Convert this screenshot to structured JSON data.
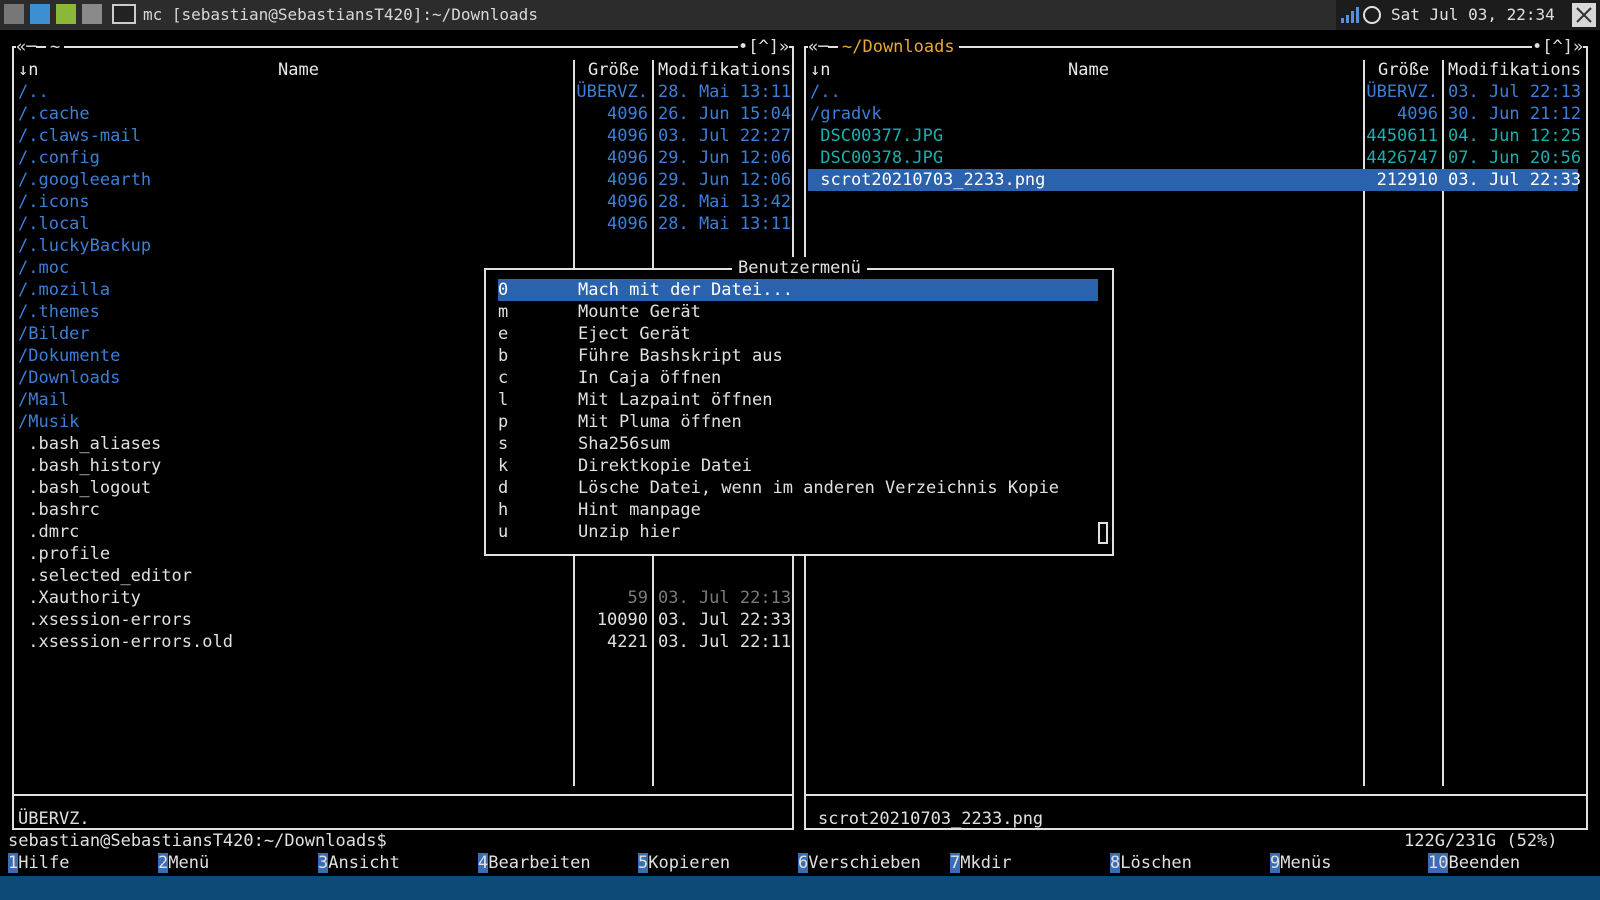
{
  "window": {
    "title": "mc [sebastian@SebastiansT420]:~/Downloads",
    "clock": "Sat Jul 03, 22:34"
  },
  "left_panel": {
    "path": "~",
    "corner": "[^]",
    "sort_col": "↓n",
    "col_name": "Name",
    "col_size": "Größe",
    "col_mtime": "Modifikations",
    "rows": [
      {
        "name": "/..",
        "size": "ÜBERVZ.",
        "mtime": "28. Mai 13:11",
        "kind": "dir"
      },
      {
        "name": "/.cache",
        "size": "4096",
        "mtime": "26. Jun 15:04",
        "kind": "dir"
      },
      {
        "name": "/.claws-mail",
        "size": "4096",
        "mtime": "03. Jul 22:27",
        "kind": "dir"
      },
      {
        "name": "/.config",
        "size": "4096",
        "mtime": "29. Jun 12:06",
        "kind": "dir"
      },
      {
        "name": "/.googleearth",
        "size": "4096",
        "mtime": "29. Jun 12:06",
        "kind": "dir"
      },
      {
        "name": "/.icons",
        "size": "4096",
        "mtime": "28. Mai 13:42",
        "kind": "dir"
      },
      {
        "name": "/.local",
        "size": "4096",
        "mtime": "28. Mai 13:11",
        "kind": "dir"
      },
      {
        "name": "/.luckyBackup",
        "size": "",
        "mtime": "",
        "kind": "dir"
      },
      {
        "name": "/.moc",
        "size": "",
        "mtime": "",
        "kind": "dir"
      },
      {
        "name": "/.mozilla",
        "size": "",
        "mtime": "",
        "kind": "dir"
      },
      {
        "name": "/.themes",
        "size": "",
        "mtime": "",
        "kind": "dir"
      },
      {
        "name": "/Bilder",
        "size": "",
        "mtime": "",
        "kind": "dir"
      },
      {
        "name": "/Dokumente",
        "size": "",
        "mtime": "",
        "kind": "dir"
      },
      {
        "name": "/Downloads",
        "size": "",
        "mtime": "",
        "kind": "dir"
      },
      {
        "name": "/Mail",
        "size": "",
        "mtime": "",
        "kind": "dir"
      },
      {
        "name": "/Musik",
        "size": "",
        "mtime": "",
        "kind": "dir"
      },
      {
        "name": " .bash_aliases",
        "size": "",
        "mtime": "",
        "kind": "file"
      },
      {
        "name": " .bash_history",
        "size": "",
        "mtime": "",
        "kind": "file"
      },
      {
        "name": " .bash_logout",
        "size": "",
        "mtime": "",
        "kind": "file"
      },
      {
        "name": " .bashrc",
        "size": "",
        "mtime": "",
        "kind": "file"
      },
      {
        "name": " .dmrc",
        "size": "",
        "mtime": "",
        "kind": "file"
      },
      {
        "name": " .profile",
        "size": "",
        "mtime": "",
        "kind": "file"
      },
      {
        "name": " .selected_editor",
        "size": "",
        "mtime": "",
        "kind": "file"
      },
      {
        "name": " .Xauthority",
        "size": "59",
        "mtime": "03. Jul 22:13",
        "kind": "dimfile"
      },
      {
        "name": " .xsession-errors",
        "size": "10090",
        "mtime": "03. Jul 22:33",
        "kind": "file"
      },
      {
        "name": " .xsession-errors.old",
        "size": "4221",
        "mtime": "03. Jul 22:11",
        "kind": "file"
      }
    ],
    "status": "ÜBERVZ."
  },
  "right_panel": {
    "path": "~/Downloads",
    "corner": "[^]",
    "sort_col": "↓n",
    "col_name": "Name",
    "col_size": "Größe",
    "col_mtime": "Modifikations",
    "rows": [
      {
        "name": "/..",
        "size": "ÜBERVZ.",
        "mtime": "03. Jul 22:13",
        "kind": "dir"
      },
      {
        "name": "/gradvk",
        "size": "4096",
        "mtime": "30. Jun 21:12",
        "kind": "dir"
      },
      {
        "name": " DSC00377.JPG",
        "size": "4450611",
        "mtime": "04. Jun 12:25",
        "kind": "img"
      },
      {
        "name": " DSC00378.JPG",
        "size": "4426747",
        "mtime": "07. Jun 20:56",
        "kind": "img"
      },
      {
        "name": " scrot20210703_2233.png",
        "size": "212910",
        "mtime": "03. Jul 22:33",
        "kind": "sel"
      }
    ],
    "status": "scrot20210703_2233.png",
    "disk": "122G/231G (52%)"
  },
  "menu": {
    "title": "Benutzermenü",
    "items": [
      {
        "key": "0",
        "label": "Mach mit der Datei..."
      },
      {
        "key": "m",
        "label": "Mounte Gerät"
      },
      {
        "key": "e",
        "label": "Eject Gerät"
      },
      {
        "key": "b",
        "label": "Führe Bashskript aus"
      },
      {
        "key": "c",
        "label": "In Caja öffnen"
      },
      {
        "key": "l",
        "label": "Mit Lazpaint öffnen"
      },
      {
        "key": "p",
        "label": "Mit Pluma öffnen"
      },
      {
        "key": "s",
        "label": "Sha256sum"
      },
      {
        "key": "k",
        "label": "Direktkopie Datei"
      },
      {
        "key": "d",
        "label": "Lösche Datei, wenn im anderen Verzeichnis Kopie"
      },
      {
        "key": "h",
        "label": "Hint manpage"
      },
      {
        "key": "u",
        "label": "Unzip hier"
      }
    ]
  },
  "prompt": "sebastian@SebastiansT420:~/Downloads$",
  "fkeys": [
    {
      "num": "1",
      "label": "Hilfe"
    },
    {
      "num": "2",
      "label": "Menü"
    },
    {
      "num": "3",
      "label": "Ansicht"
    },
    {
      "num": "4",
      "label": "Bearbeiten"
    },
    {
      "num": "5",
      "label": "Kopieren"
    },
    {
      "num": "6",
      "label": "Verschieben"
    },
    {
      "num": "7",
      "label": "Mkdir"
    },
    {
      "num": "8",
      "label": "Löschen"
    },
    {
      "num": "9",
      "label": "Menüs"
    },
    {
      "num": "10",
      "label": "Beenden"
    }
  ],
  "colors": {
    "dir": "#3d7fd8",
    "image": "#18b0b0",
    "selection": "#2b62ad",
    "fkey_bg": "#3a6db5"
  }
}
